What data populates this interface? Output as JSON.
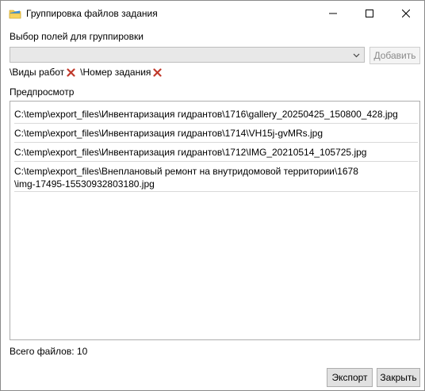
{
  "window": {
    "title": "Группировка файлов задания",
    "icon": "folder-icon"
  },
  "grouping": {
    "label": "Выбор полей для группировки",
    "combo_value": "",
    "add_label": "Добавить",
    "tags": [
      {
        "label": "\\Виды работ"
      },
      {
        "label": "\\Номер задания"
      }
    ]
  },
  "preview": {
    "label": "Предпросмотр",
    "items": [
      "C:\\temp\\export_files\\Инвентаризация гидрантов\\1716\\gallery_20250425_150800_428.jpg",
      "C:\\temp\\export_files\\Инвентаризация гидрантов\\1714\\VH15j-gvMRs.jpg",
      "C:\\temp\\export_files\\Инвентаризация гидрантов\\1712\\IMG_20210514_105725.jpg",
      "C:\\temp\\export_files\\Внеплановый ремонт на внутридомовой территории\\1678\n\\img-17495-15530932803180.jpg"
    ]
  },
  "footer": {
    "total": "Всего файлов: 10",
    "export_label": "Экспорт",
    "close_label": "Закрыть"
  },
  "colors": {
    "tag_remove": "#c0392b",
    "icon_yellow": "#f2c94c",
    "icon_blue": "#3b8fd9"
  }
}
